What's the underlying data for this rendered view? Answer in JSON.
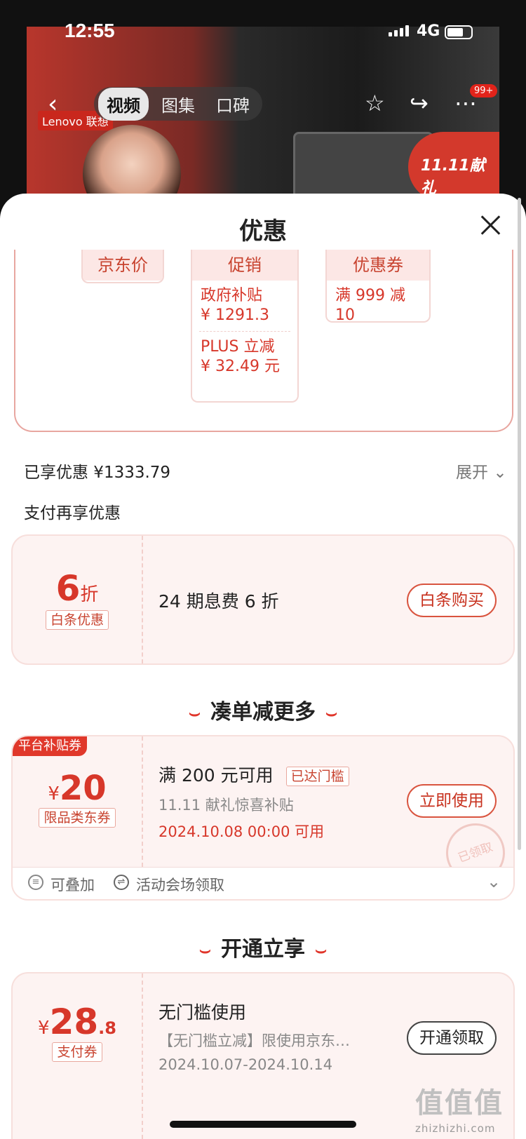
{
  "status": {
    "time": "12:55",
    "network": "4G"
  },
  "topnav": {
    "tabs": [
      "视频",
      "图集",
      "口碑"
    ],
    "badge": "99+",
    "hero_brand": "Lenovo 联想",
    "hero_promo": "11.11献礼"
  },
  "sheet": {
    "title": "优惠",
    "price_cards": {
      "jd_price": {
        "label": "京东价"
      },
      "promo": {
        "label": "促销",
        "items": [
          {
            "name": "政府补贴",
            "value": "¥ 1291.3"
          },
          {
            "name": "PLUS 立减",
            "value": "¥ 32.49 元"
          }
        ]
      },
      "coupon": {
        "label": "优惠券",
        "item": "满 999 减 10"
      }
    },
    "enjoyed": "已享优惠 ¥1333.79",
    "expand": "展开",
    "pay_more": "支付再享优惠",
    "baitiao": {
      "discount_num": "6",
      "discount_unit": "折",
      "tag": "白条优惠",
      "desc": "24 期息费 6 折",
      "button": "白条购买"
    },
    "section1": "凑单减更多",
    "platform_coupon": {
      "corner_tag": "平台补贴券",
      "currency": "¥",
      "amount": "20",
      "tag": "限品类东券",
      "title": "满 200 元可用",
      "status_tag": "已达门槛",
      "subtitle": "11.11 献礼惊喜补贴",
      "date": "2024.10.08 00:00 可用",
      "button": "立即使用",
      "stamp": "已领取",
      "footer_stack": "可叠加",
      "footer_source": "活动会场领取"
    },
    "section2": "开通立享",
    "pay_coupon": {
      "currency": "¥",
      "amount_main": "28",
      "amount_decimal": ".8",
      "tag": "支付券",
      "title": "无门槛使用",
      "subtitle": "【无门槛立减】限使用京东…",
      "date": "2024.10.07-2024.10.14",
      "button": "开通领取"
    }
  },
  "watermark": {
    "main": "值值值",
    "site": "zhizhizhi.com"
  }
}
